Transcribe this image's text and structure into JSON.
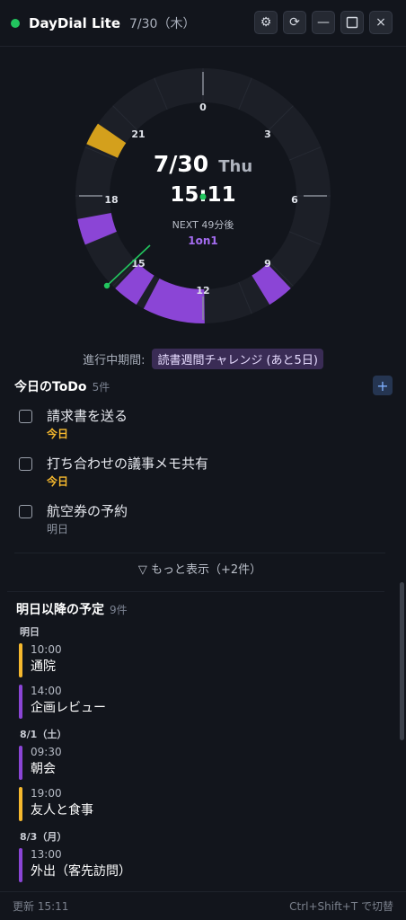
{
  "titlebar": {
    "app_name": "DayDial Lite",
    "date": "7/30（木）",
    "settings_glyph": "⚙",
    "refresh_glyph": "⟳",
    "minimize_glyph": "—",
    "close_glyph": "×"
  },
  "clock": {
    "date": "7/30",
    "weekday": "Thu",
    "time": "15:11",
    "next_label": "NEXT 49分後",
    "next_event": "1on1",
    "hour_labels": {
      "h0": "0",
      "h3": "3",
      "h6": "6",
      "h9": "9",
      "h12": "12",
      "h15": "15",
      "h18": "18",
      "h21": "21"
    },
    "colors": {
      "work": "#8b45d6",
      "personal": "#d4a01c",
      "now": "#22c55e"
    }
  },
  "period": {
    "label": "進行中期間:",
    "badge": "読書週間チャレンジ (あと5日)"
  },
  "todo": {
    "title": "今日のToDo",
    "count": "5件",
    "add_label": "+",
    "items": [
      {
        "text": "請求書を送る",
        "due": "今日"
      },
      {
        "text": "打ち合わせの議事メモ共有",
        "due": "今日"
      },
      {
        "text": "航空券の予約",
        "due": "明日"
      }
    ],
    "more": "▽ もっと表示（+2件）"
  },
  "upcoming": {
    "title": "明日以降の予定",
    "count": "9件",
    "groups": [
      {
        "day": "明日",
        "events": [
          {
            "time": "10:00",
            "title": "通院",
            "color": "#f5b82e"
          },
          {
            "time": "14:00",
            "title": "企画レビュー",
            "color": "#8b45d6"
          }
        ]
      },
      {
        "day": "8/1（土）",
        "events": [
          {
            "time": "09:30",
            "title": "朝会",
            "color": "#8b45d6"
          },
          {
            "time": "19:00",
            "title": "友人と食事",
            "color": "#f5b82e"
          }
        ]
      },
      {
        "day": "8/3（月）",
        "events": [
          {
            "time": "13:00",
            "title": "外出（客先訪問）",
            "color": "#8b45d6"
          }
        ]
      }
    ]
  },
  "footer": {
    "updated": "更新 15:11",
    "shortcut": "Ctrl+Shift+T で切替"
  }
}
